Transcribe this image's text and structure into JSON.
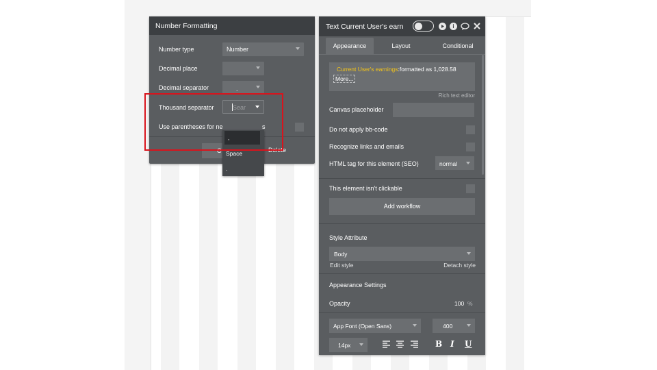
{
  "number_formatting": {
    "title": "Number Formatting",
    "number_type_label": "Number type",
    "number_type_value": "Number",
    "decimal_place_label": "Decimal place",
    "decimal_place_value": "",
    "decimal_separator_label": "Decimal separator",
    "decimal_separator_value": ".",
    "thousand_separator_label": "Thousand separator",
    "thousand_separator_value": "Sear",
    "parentheses_label": "Use parentheses for ne",
    "parentheses_label_tail": "s",
    "close_label": "C",
    "delete_label": "Delete",
    "dropdown_options": [
      ",",
      "Space",
      "."
    ]
  },
  "property_editor": {
    "title": "Text Current User's earn",
    "tabs": [
      "Appearance",
      "Layout",
      "Conditional"
    ],
    "active_tab": "Appearance",
    "expression_dynamic": "Current User's earnings",
    "expression_static": ":formatted as 1,028.58",
    "more_label": "More...",
    "rich_text_editor": "Rich text editor",
    "canvas_placeholder_label": "Canvas placeholder",
    "canvas_placeholder_value": "",
    "no_bbcode_label": "Do not apply bb-code",
    "recognize_links_label": "Recognize links and emails",
    "html_tag_label": "HTML tag for this element (SEO)",
    "html_tag_value": "normal",
    "not_clickable_label": "This element isn't clickable",
    "add_workflow_label": "Add workflow",
    "style_attribute_label": "Style Attribute",
    "style_value": "Body",
    "edit_style": "Edit style",
    "detach_style": "Detach style",
    "appearance_settings": "Appearance Settings",
    "opacity_label": "Opacity",
    "opacity_value": "100",
    "opacity_unit": "%",
    "font_value": "App Font (Open Sans)",
    "weight_value": "400",
    "size_value": "14px",
    "bold": "B",
    "italic": "I",
    "underline": "U"
  },
  "colors": {
    "panel": "#5a5d60",
    "header": "#3c3f42",
    "dynamic_text": "#f5c518",
    "highlight": "#d9131c"
  }
}
